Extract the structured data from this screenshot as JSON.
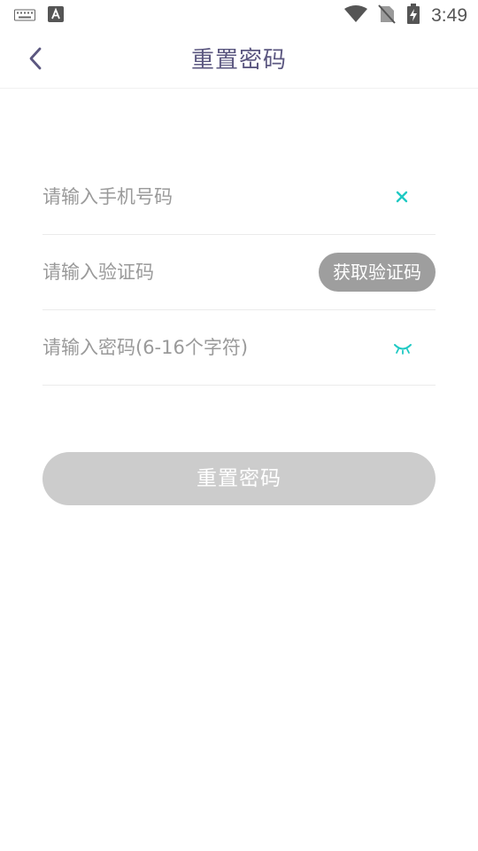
{
  "status_bar": {
    "time": "3:49",
    "icons": [
      "keyboard-icon",
      "a-letter-notification-icon",
      "wifi-icon",
      "no-sim-icon",
      "battery-charging-icon"
    ]
  },
  "header": {
    "title": "重置密码",
    "back_icon": "chevron-left-icon"
  },
  "form": {
    "phone": {
      "placeholder": "请输入手机号码",
      "value": "",
      "clear_icon": "close-icon"
    },
    "code": {
      "placeholder": "请输入验证码",
      "value": "",
      "button_label": "获取验证码"
    },
    "password": {
      "placeholder": "请输入密码(6-16个字符)",
      "value": "",
      "toggle_icon": "eye-closed-icon"
    }
  },
  "submit": {
    "label": "重置密码"
  },
  "colors": {
    "title": "#5b5780",
    "accent": "#1ec9c3",
    "button_disabled": "#cccccc",
    "code_button": "#9e9e9e"
  }
}
